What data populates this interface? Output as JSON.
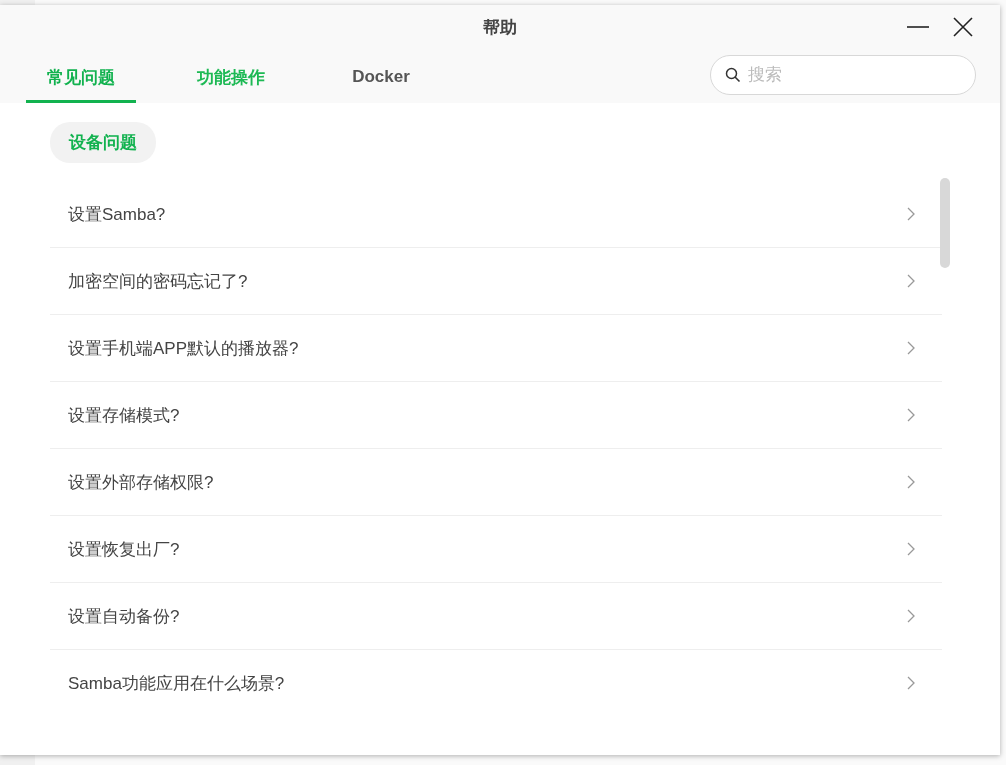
{
  "window": {
    "title": "帮助"
  },
  "tabs": [
    {
      "label": "常见问题",
      "selected": true,
      "hovered": false
    },
    {
      "label": "功能操作",
      "selected": false,
      "hovered": true
    },
    {
      "label": "Docker",
      "selected": false,
      "hovered": false
    }
  ],
  "search": {
    "placeholder": "搜索"
  },
  "category": {
    "label": "设备问题"
  },
  "questions": [
    "设置Samba?",
    "加密空间的密码忘记了?",
    "设置手机端APP默认的播放器?",
    "设置存储模式?",
    "设置外部存储权限?",
    "设置恢复出厂?",
    "设置自动备份?",
    "Samba功能应用在什么场景?"
  ]
}
